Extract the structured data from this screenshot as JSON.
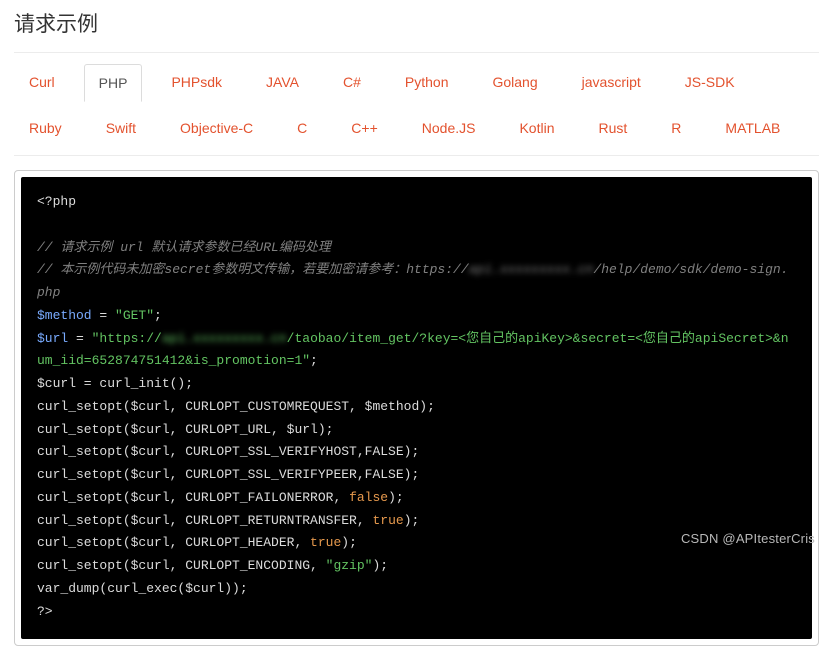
{
  "title": "请求示例",
  "tabs": [
    {
      "label": "Curl",
      "active": false
    },
    {
      "label": "PHP",
      "active": true
    },
    {
      "label": "PHPsdk",
      "active": false
    },
    {
      "label": "JAVA",
      "active": false
    },
    {
      "label": "C#",
      "active": false
    },
    {
      "label": "Python",
      "active": false
    },
    {
      "label": "Golang",
      "active": false
    },
    {
      "label": "javascript",
      "active": false
    },
    {
      "label": "JS-SDK",
      "active": false
    },
    {
      "label": "Ruby",
      "active": false
    },
    {
      "label": "Swift",
      "active": false
    },
    {
      "label": "Objective-C",
      "active": false
    },
    {
      "label": "C",
      "active": false
    },
    {
      "label": "C++",
      "active": false
    },
    {
      "label": "Node.JS",
      "active": false
    },
    {
      "label": "Kotlin",
      "active": false
    },
    {
      "label": "Rust",
      "active": false
    },
    {
      "label": "R",
      "active": false
    },
    {
      "label": "MATLAB",
      "active": false
    }
  ],
  "code": {
    "open_tag": "<?php",
    "comment1": "// 请求示例 url 默认请求参数已经URL编码处理",
    "comment2_prefix": "// 本示例代码未加密secret参数明文传输，若要加密请参考：https://",
    "comment2_blur": "api.xxxxxxxxx.cn",
    "comment2_suffix": "/help/demo/sdk/demo-sign.php",
    "method_var": "$method",
    "method_val": "\"GET\"",
    "url_var": "$url",
    "url_prefix": "\"https://",
    "url_blur": "api.xxxxxxxxx.cn",
    "url_suffix": "/taobao/item_get/?key=<您自己的apiKey>&secret=<您自己的apiSecret>&num_iid=652874751412&is_promotion=1\"",
    "curl_init": "$curl = curl_init();",
    "setopt_customrequest": "curl_setopt($curl, CURLOPT_CUSTOMREQUEST, $method);",
    "setopt_url": "curl_setopt($curl, CURLOPT_URL, $url);",
    "setopt_verifyhost": "curl_setopt($curl, CURLOPT_SSL_VERIFYHOST,FALSE);",
    "setopt_verifypeer": "curl_setopt($curl, CURLOPT_SSL_VERIFYPEER,FALSE);",
    "setopt_failonerror_pre": "curl_setopt($curl, CURLOPT_FAILONERROR, ",
    "false_kw": "false",
    "setopt_returntransfer_pre": "curl_setopt($curl, CURLOPT_RETURNTRANSFER, ",
    "true_kw": "true",
    "setopt_header_pre": "curl_setopt($curl, CURLOPT_HEADER, ",
    "setopt_encoding_pre": "curl_setopt($curl, CURLOPT_ENCODING, ",
    "gzip_str": "\"gzip\"",
    "closing_paren": ");",
    "vardump": "var_dump(curl_exec($curl));",
    "close_tag": "?>",
    "semicolon": ";",
    "equals": " = "
  },
  "watermark": "CSDN @APItesterCris"
}
